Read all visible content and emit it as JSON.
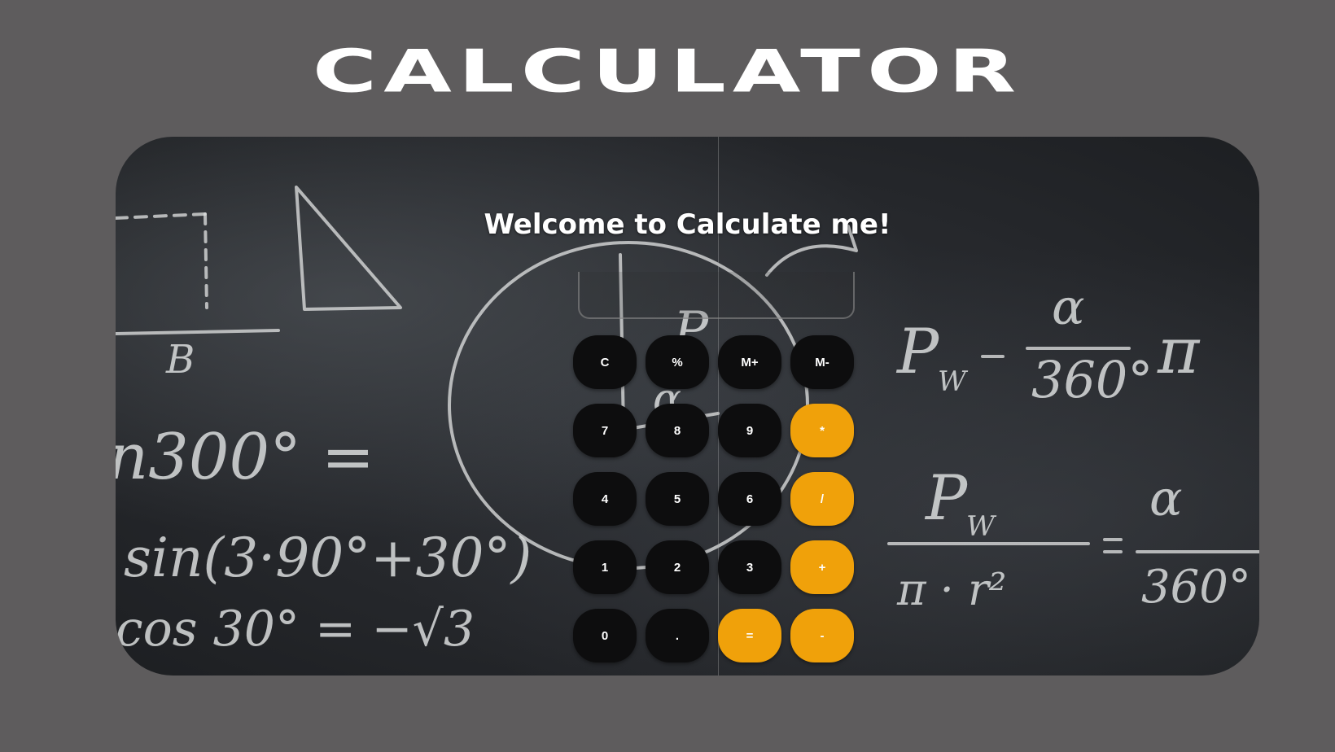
{
  "header": {
    "title": "CALCULATOR"
  },
  "calculator": {
    "welcome": "Welcome to Calculate me!",
    "display_value": "",
    "keys": [
      {
        "label": "C",
        "type": "function"
      },
      {
        "label": "%",
        "type": "function"
      },
      {
        "label": "M+",
        "type": "function"
      },
      {
        "label": "M-",
        "type": "function"
      },
      {
        "label": "7",
        "type": "digit"
      },
      {
        "label": "8",
        "type": "digit"
      },
      {
        "label": "9",
        "type": "digit"
      },
      {
        "label": "*",
        "type": "operator"
      },
      {
        "label": "4",
        "type": "digit"
      },
      {
        "label": "5",
        "type": "digit"
      },
      {
        "label": "6",
        "type": "digit"
      },
      {
        "label": "/",
        "type": "operator"
      },
      {
        "label": "1",
        "type": "digit"
      },
      {
        "label": "2",
        "type": "digit"
      },
      {
        "label": "3",
        "type": "digit"
      },
      {
        "label": "+",
        "type": "operator"
      },
      {
        "label": "0",
        "type": "digit"
      },
      {
        "label": ".",
        "type": "digit"
      },
      {
        "label": "=",
        "type": "operator"
      },
      {
        "label": "-",
        "type": "operator"
      }
    ]
  },
  "colors": {
    "page_background": "#5e5c5d",
    "board_background": "#2a2c30",
    "key_dark": "#0d0d0e",
    "key_accent": "#f0a10a",
    "text": "#ffffff"
  },
  "background_image": {
    "chalk_texts": [
      "B",
      "n300° =",
      "sin(3·90°+30°)",
      "cos 30° = −√3",
      "P",
      "α",
      "P",
      "W",
      "α",
      "360°",
      "π",
      "P",
      "W",
      "π · r²",
      "α",
      "360°"
    ]
  }
}
